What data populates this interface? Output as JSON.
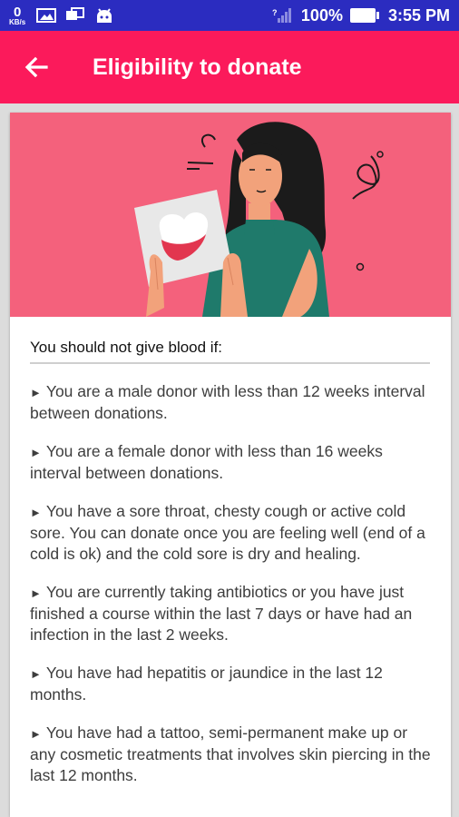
{
  "status_bar": {
    "speed_value": "0",
    "speed_unit": "KB/s",
    "battery": "100%",
    "time": "3:55 PM"
  },
  "app_bar": {
    "title": "Eligibility to donate",
    "back_icon": "arrow-left-icon"
  },
  "content": {
    "heading": "You should not give blood if:",
    "bullet": "►",
    "items": [
      "You are a male donor with less than 12 weeks interval between donations.",
      "You are a female donor with less than 16 weeks interval between donations.",
      "You have a sore throat, chesty cough or active cold sore. You can donate once you are feeling well (end of a cold is ok) and the cold sore is dry and healing.",
      "You are currently taking antibiotics or you have just finished a course within the last 7 days or have had an infection in the last 2 weeks.",
      "You have had hepatitis or jaundice in the last 12 months.",
      "You have had a tattoo, semi-permanent make up or any cosmetic treatments that involves skin piercing in the last 12 months."
    ]
  },
  "colors": {
    "status_bar": "#2b2cc0",
    "app_bar": "#fb1a5b",
    "banner": "#f4617c"
  }
}
